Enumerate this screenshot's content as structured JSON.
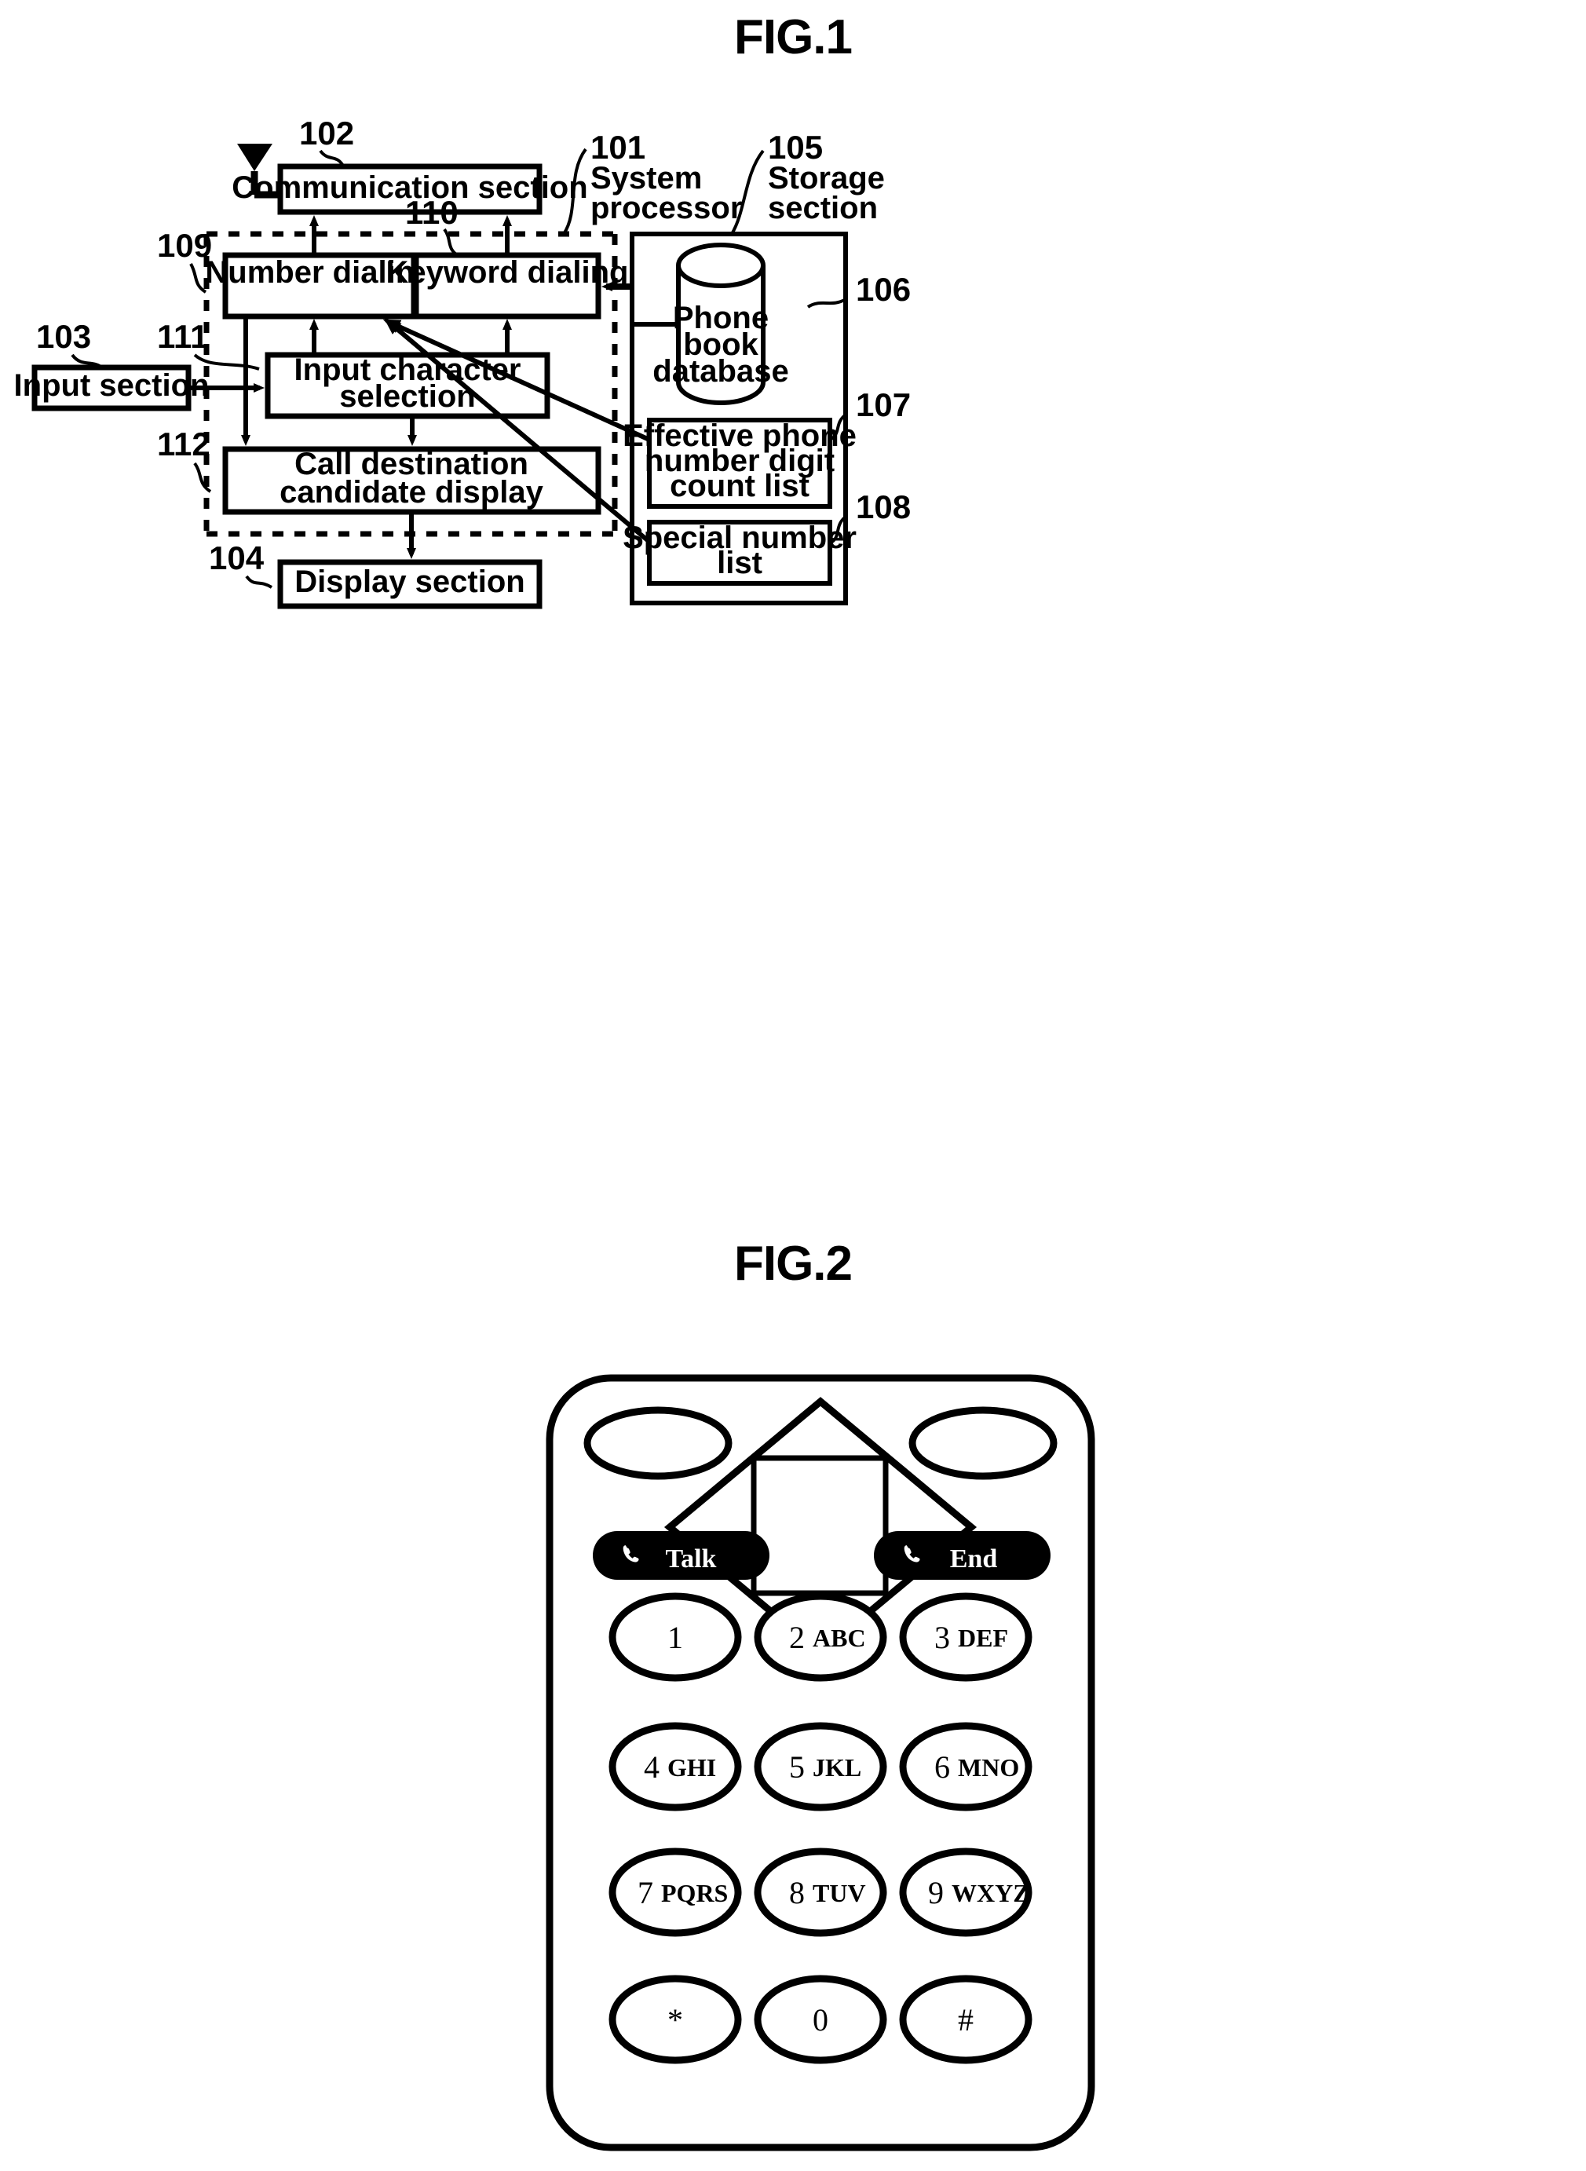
{
  "figures": [
    {
      "id": "fig1",
      "title": "FIG.1",
      "blocks": [
        {
          "key": "communication_section",
          "label": "Communication section",
          "ref": "102"
        },
        {
          "key": "number_dialing",
          "label": "Number dialing",
          "ref": "109"
        },
        {
          "key": "keyword_dialing",
          "label": "Keyword dialing",
          "ref": "110"
        },
        {
          "key": "input_section",
          "label": "Input section",
          "ref": "103"
        },
        {
          "key": "input_character_selection",
          "label_line1": "Input character",
          "label_line2": "selection",
          "ref": "111"
        },
        {
          "key": "call_destination_candidate_display",
          "label_line1": "Call destination",
          "label_line2": "candidate display",
          "ref": "112"
        },
        {
          "key": "display_section",
          "label": "Display section",
          "ref": "104"
        },
        {
          "key": "phone_book_database",
          "label_line1": "Phone",
          "label_line2": "book",
          "label_line3": "database",
          "ref": "106"
        },
        {
          "key": "effective_phone_number_digit_count_list",
          "label_line1": "Effective phone",
          "label_line2": "number digit",
          "label_line3": "count list",
          "ref": "107"
        },
        {
          "key": "special_number_list",
          "label_line1": "Special number",
          "label_line2": "list",
          "ref": "108"
        }
      ],
      "groups": [
        {
          "key": "system_processor",
          "ref": "101",
          "line1": "System",
          "line2": "processor"
        },
        {
          "key": "storage_section",
          "ref": "105",
          "line1": "Storage",
          "line2": "section"
        }
      ],
      "refs": {
        "r101": "101",
        "r102": "102",
        "r103": "103",
        "r104": "104",
        "r105": "105",
        "r106": "106",
        "r107": "107",
        "r108": "108",
        "r109": "109",
        "r110": "110",
        "r111": "111",
        "r112": "112"
      },
      "labels": {
        "communication_section": "Communication section",
        "number_dialing": "Number dialing",
        "keyword_dialing": "Keyword dialing",
        "input_section": "Input section",
        "input_char_sel_1": "Input character",
        "input_char_sel_2": "selection",
        "call_dest_1": "Call destination",
        "call_dest_2": "candidate display",
        "display_section": "Display section",
        "phone_book_1": "Phone",
        "phone_book_2": "book",
        "phone_book_3": "database",
        "effective_1": "Effective phone",
        "effective_2": "number digit",
        "effective_3": "count list",
        "special_1": "Special number",
        "special_2": "list",
        "system_processor_1": "System",
        "system_processor_2": "processor",
        "storage_section_1": "Storage",
        "storage_section_2": "section"
      }
    },
    {
      "id": "fig2",
      "title": "FIG.2",
      "softkeys": [
        {
          "key": "talk",
          "label": "Talk",
          "icon": "phone-handset-icon"
        },
        {
          "key": "end",
          "label": "End",
          "icon": "phone-handset-icon"
        }
      ],
      "softkey_labels": {
        "talk": "Talk",
        "end": "End"
      },
      "keypad": [
        {
          "digit": "1",
          "letters": ""
        },
        {
          "digit": "2",
          "letters": "ABC"
        },
        {
          "digit": "3",
          "letters": "DEF"
        },
        {
          "digit": "4",
          "letters": "GHI"
        },
        {
          "digit": "5",
          "letters": "JKL"
        },
        {
          "digit": "6",
          "letters": "MNO"
        },
        {
          "digit": "7",
          "letters": "PQRS"
        },
        {
          "digit": "8",
          "letters": "TUV"
        },
        {
          "digit": "9",
          "letters": "WXYZ"
        },
        {
          "digit": "*",
          "letters": ""
        },
        {
          "digit": "0",
          "letters": ""
        },
        {
          "digit": "#",
          "letters": ""
        }
      ]
    }
  ],
  "colors": {
    "ink": "#000000",
    "paper": "#ffffff",
    "softkey_fill": "#000000",
    "softkey_text": "#ffffff"
  }
}
